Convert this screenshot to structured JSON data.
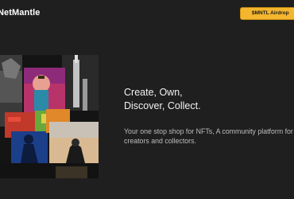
{
  "header": {
    "logo_text": "NetMantle",
    "airdrop_button_label": "$MNTL Airdrop"
  },
  "hero": {
    "headline_line1": "Create, Own,",
    "headline_line2": "Discover, Collect.",
    "subtext": "Your one stop shop for NFTs, A community platform for creators and collectors."
  },
  "colors": {
    "background": "#1f1f1f",
    "accent": "#f3b62e"
  }
}
